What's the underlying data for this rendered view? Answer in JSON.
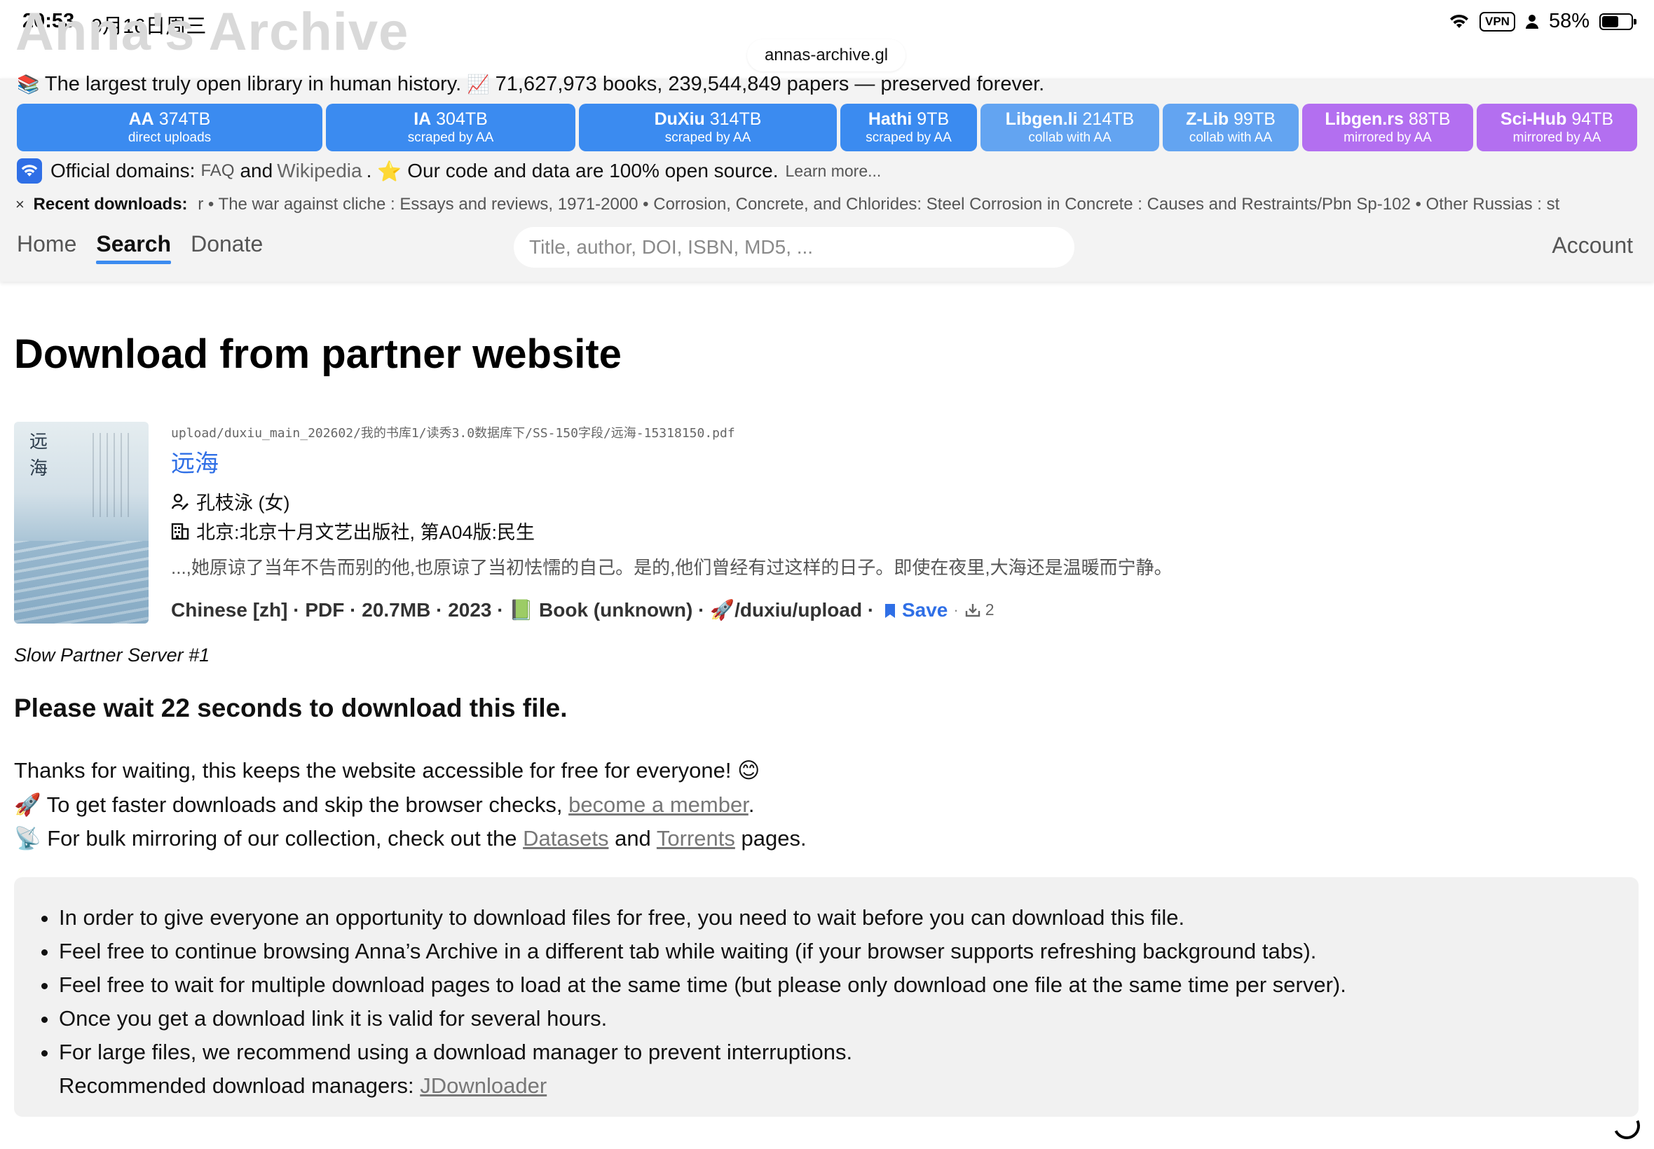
{
  "status_bar": {
    "time": "20:53",
    "date": "9月16日周三",
    "vpn": "VPN",
    "battery": "58%",
    "battery_level": 0.58
  },
  "browser": {
    "url": "annas-archive.gl"
  },
  "site": {
    "ghost_title": "Anna's Archive",
    "tagline_part1": "The largest truly open library in human history.",
    "tagline_part2": "71,627,973 books, 239,544,849 papers — preserved forever."
  },
  "sources": [
    {
      "name": "AA",
      "size": "374TB",
      "sub": "direct uploads"
    },
    {
      "name": "IA",
      "size": "304TB",
      "sub": "scraped by AA"
    },
    {
      "name": "DuXiu",
      "size": "314TB",
      "sub": "scraped by AA"
    },
    {
      "name": "Hathi",
      "size": "9TB",
      "sub": "scraped by AA"
    },
    {
      "name": "Libgen.li",
      "size": "214TB",
      "sub": "collab with AA"
    },
    {
      "name": "Z-Lib",
      "size": "99TB",
      "sub": "collab with AA"
    },
    {
      "name": "Libgen.rs",
      "size": "88TB",
      "sub": "mirrored by AA"
    },
    {
      "name": "Sci-Hub",
      "size": "94TB",
      "sub": "mirrored by AA"
    }
  ],
  "domains": {
    "official": "Official domains:",
    "faq": "FAQ",
    "and": "and",
    "wikipedia": "Wikipedia",
    "open_source": "Our code and data are 100% open source.",
    "learn_more": "Learn more..."
  },
  "recent": {
    "close": "×",
    "label": "Recent downloads:",
    "items": "r • The war against cliche : Essays and reviews, 1971-2000 • Corrosion, Concrete, and Chlorides: Steel Corrosion in Concrete : Causes and Restraints/Pbn Sp-102 • Other Russias : st"
  },
  "nav": {
    "home": "Home",
    "search": "Search",
    "donate": "Donate",
    "search_placeholder": "Title, author, DOI, ISBN, MD5, ...",
    "account": "Account"
  },
  "main": {
    "page_title": "Download from partner website",
    "book": {
      "cover_chars": [
        "远",
        "海"
      ],
      "path": "upload/duxiu_main_202602/我的书库1/读秀3.0数据库下/SS-150字段/远海-15318150.pdf",
      "title": "远海",
      "author": "孔枝泳 (女)",
      "publisher": "北京:北京十月文艺出版社, 第A04版:民生",
      "description": "...,她原谅了当年不告而别的他,也原谅了当初怯懦的自己。是的,他们曾经有过这样的日子。即使在夜里,大海还是温暖而宁静。",
      "language": "Chinese [zh]",
      "format": "PDF",
      "size": "20.7MB",
      "year": "2023",
      "type": "Book (unknown)",
      "source": "/duxiu/upload",
      "save": "Save",
      "count": "2"
    },
    "server": "Slow Partner Server #1",
    "wait": "Please wait 22 seconds to download this file.",
    "thanks": "Thanks for waiting, this keeps the website accessible for free for everyone!",
    "faster_pre": "To get faster downloads and skip the browser checks,",
    "faster_link": "become a member",
    "faster_post": ".",
    "bulk_pre": "For bulk mirroring of our collection, check out the",
    "datasets": "Datasets",
    "and": "and",
    "torrents": "Torrents",
    "bulk_post": "pages.",
    "tips": [
      "In order to give everyone an opportunity to download files for free, you need to wait before you can download this file.",
      "Feel free to continue browsing Anna’s Archive in a different tab while waiting (if your browser supports refreshing background tabs).",
      "Feel free to wait for multiple download pages to load at the same time (but please only download one file at the same time per server).",
      "Once you get a download link it is valid for several hours.",
      "For large files, we recommend using a download manager to prevent interruptions."
    ],
    "recommended_label": "Recommended download managers:",
    "recommended_link": "JDownloader"
  }
}
